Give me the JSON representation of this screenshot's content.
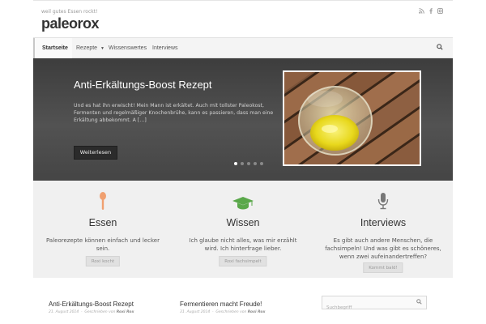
{
  "header": {
    "tagline": "weil gutes Essen rockt!",
    "site_title": "paleorox",
    "social_icons": [
      "rss-icon",
      "facebook-icon",
      "instagram-icon"
    ]
  },
  "nav": {
    "items": [
      {
        "label": "Startseite",
        "active": true
      },
      {
        "label": "Rezepte",
        "has_dropdown": true
      },
      {
        "label": "Wissenswertes"
      },
      {
        "label": "Interviews"
      }
    ],
    "search_icon": "search-icon"
  },
  "slider": {
    "title": "Anti-Erkältungs-Boost Rezept",
    "excerpt": "Und es hat ihn erwischt! Mein Mann ist erkältet. Auch mit tollster Paleokost, Fermenten und regelmäßiger Knochenbrühe, kann es passieren, dass man eine Erkältung abbekommt. A […]",
    "button": "Weiterlesen",
    "slide_count": 5,
    "active_slide": 1
  },
  "features": [
    {
      "icon": "spoon-icon",
      "title": "Essen",
      "text": "Paleorezepte können einfach und lecker sein.",
      "button": "Roxi kocht"
    },
    {
      "icon": "graduation-cap-icon",
      "title": "Wissen",
      "text": "Ich glaube nicht alles, was mir erzählt wird. Ich hinterfrage lieber.",
      "button": "Roxi fachsimpelt"
    },
    {
      "icon": "microphone-icon",
      "title": "Interviews",
      "text": "Es gibt auch andere Menschen, die fachsimpeln! Und was gibt es schöneres, wenn zwei aufeinandertreffen?",
      "button": "Kommt bald!"
    }
  ],
  "posts": [
    {
      "title": "Anti-Erkältungs-Boost Rezept",
      "date": "21. August 2014",
      "meta_prefix": "Geschrieben von",
      "author": "Roxi Rox"
    },
    {
      "title": "Fermentieren macht Freude!",
      "date": "31. August 2014",
      "meta_prefix": "Geschrieben von",
      "author": "Roxi Rox"
    }
  ],
  "search": {
    "placeholder": "Suchbegriff"
  },
  "colors": {
    "accent_orange": "#f0a070",
    "accent_green": "#5aa84a",
    "slider_bg": "#474747",
    "feature_bg": "#f0f0f0"
  }
}
